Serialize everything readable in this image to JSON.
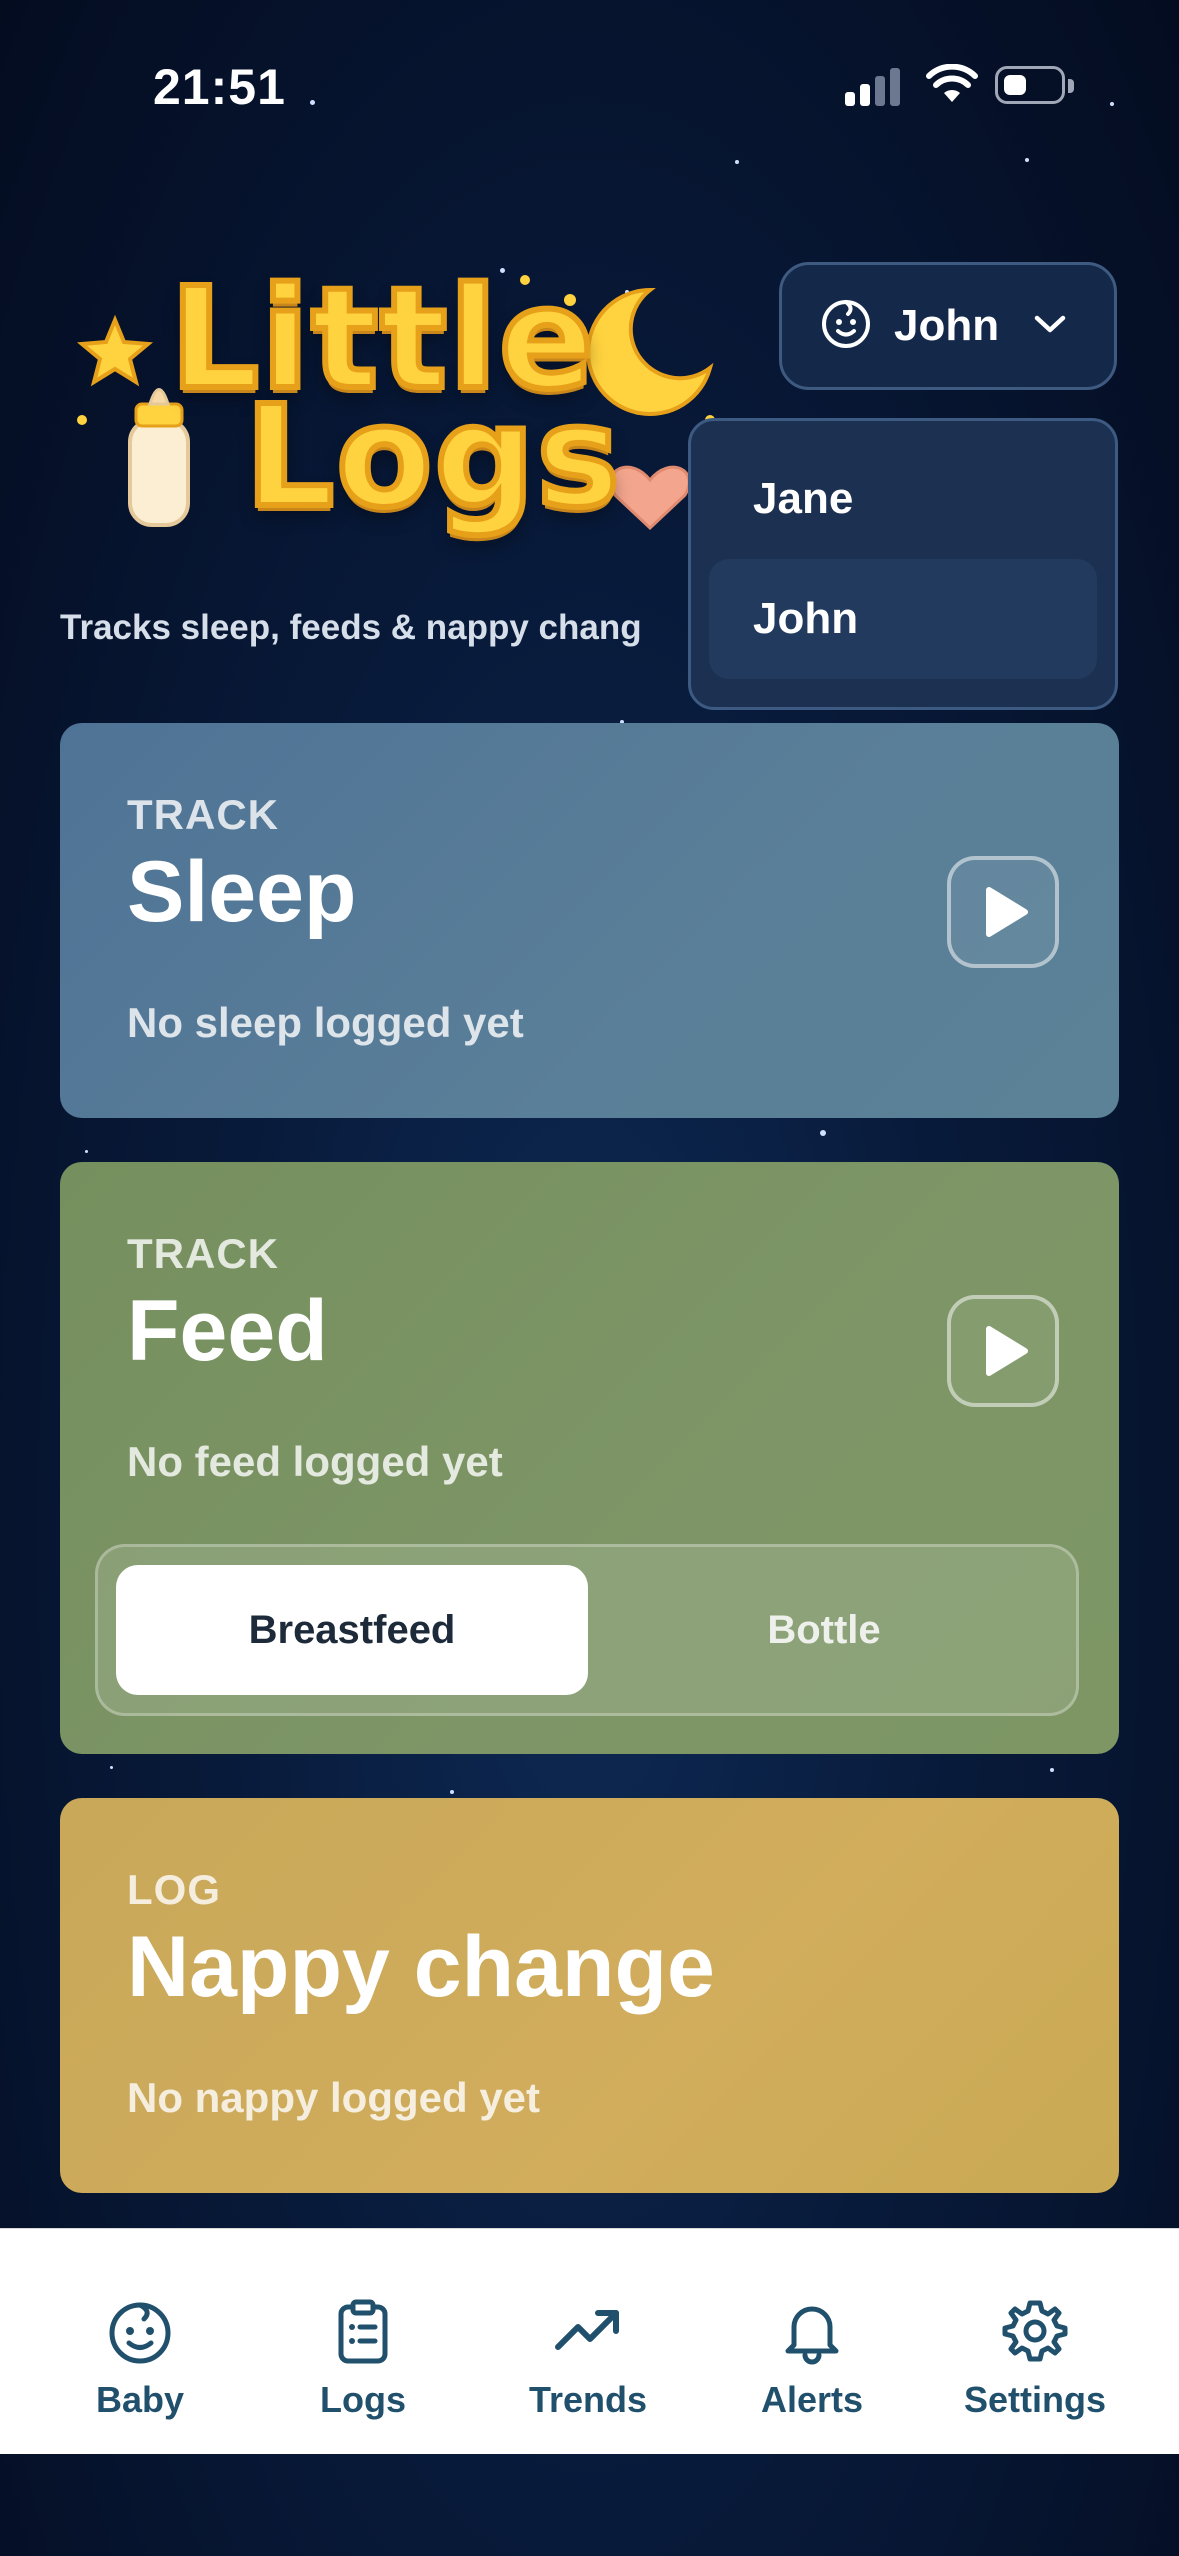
{
  "status_bar": {
    "time": "21:51"
  },
  "header": {
    "logo_line1": "Little",
    "logo_line2": "Logs",
    "tagline": "Tracks sleep, feeds & nappy chang"
  },
  "baby_selector": {
    "selected": "John",
    "icon": "baby-face-icon",
    "options": [
      {
        "label": "Jane",
        "selected": false
      },
      {
        "label": "John",
        "selected": true
      }
    ]
  },
  "cards": {
    "sleep": {
      "kicker": "TRACK",
      "title": "Sleep",
      "status": "No sleep logged yet",
      "color": "#587c98"
    },
    "feed": {
      "kicker": "TRACK",
      "title": "Feed",
      "status": "No feed logged yet",
      "color": "#7b9462",
      "modes": [
        {
          "label": "Breastfeed",
          "active": true
        },
        {
          "label": "Bottle",
          "active": false
        }
      ]
    },
    "nappy": {
      "kicker": "LOG",
      "title": "Nappy change",
      "status": "No nappy logged yet",
      "color": "#cdab5a"
    }
  },
  "tab_bar": {
    "items": [
      {
        "label": "Baby",
        "icon": "baby-face-icon"
      },
      {
        "label": "Logs",
        "icon": "clipboard-list-icon"
      },
      {
        "label": "Trends",
        "icon": "trending-up-icon"
      },
      {
        "label": "Alerts",
        "icon": "bell-icon"
      },
      {
        "label": "Settings",
        "icon": "gear-icon"
      }
    ],
    "color": "#20506c"
  }
}
